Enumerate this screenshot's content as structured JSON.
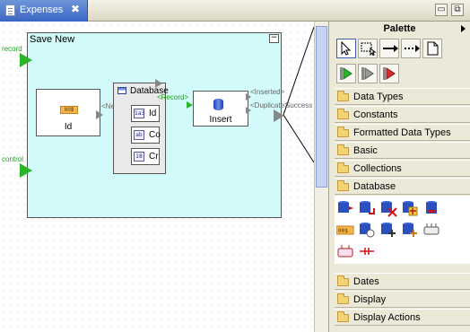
{
  "tab": {
    "title": "Expenses",
    "close_glyph": "✖"
  },
  "window_buttons": {
    "minimize": "▭",
    "maximize": "⧉"
  },
  "canvas": {
    "subprocess_title": "Save New",
    "inputs": [
      {
        "label": "record"
      },
      {
        "label": "control"
      }
    ],
    "id_component": {
      "label": "Id",
      "icon": "00$"
    },
    "database_component": {
      "label": "Database",
      "next_label": "<Next>",
      "fields": [
        {
          "icon": "1a3",
          "text": "Id"
        },
        {
          "icon": "ab",
          "text": "Co"
        },
        {
          "icon": "18",
          "text": "Cr"
        }
      ]
    },
    "insert_component": {
      "label": "Insert",
      "input_label": "<Record>",
      "outputs": [
        "<Inserted>",
        "<Duplicate>",
        "Success"
      ]
    }
  },
  "palette": {
    "title": "Palette",
    "drawers": [
      {
        "label": "Data Types"
      },
      {
        "label": "Constants"
      },
      {
        "label": "Formatted Data Types"
      },
      {
        "label": "Basic"
      },
      {
        "label": "Collections"
      },
      {
        "label": "Database"
      },
      {
        "label": "Dates"
      },
      {
        "label": "Display"
      },
      {
        "label": "Display Actions"
      }
    ]
  }
}
